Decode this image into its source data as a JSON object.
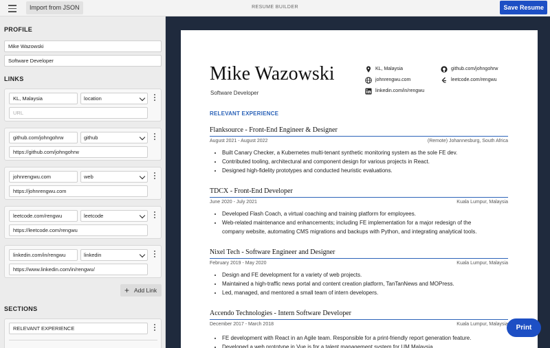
{
  "header": {
    "import_label": "Import from JSON",
    "app_title": "RESUME BUILDER",
    "save_label": "Save Resume"
  },
  "sidebar": {
    "profile_heading": "PROFILE",
    "name_value": "Mike Wazowski",
    "title_value": "Software Developer",
    "links_heading": "LINKS",
    "links": [
      {
        "label": "KL, Malaysia",
        "type": "location",
        "url": "",
        "url_placeholder": "URL"
      },
      {
        "label": "github.com/johngohrw",
        "type": "github",
        "url": "https://github.com/johngohrw"
      },
      {
        "label": "johnrengwu.com",
        "type": "web",
        "url": "https://johnrengwu.com"
      },
      {
        "label": "leetcode.com/rengwu",
        "type": "leetcode",
        "url": "https://leetcode.com/rengwu"
      },
      {
        "label": "linkedin.com/in/rengwu",
        "type": "linkedin",
        "url": "https://www.linkedin.com/in/rengwu/"
      }
    ],
    "add_link_label": "Add Link",
    "sections_heading": "SECTIONS",
    "section_items": [
      "RELEVANT EXPERIENCE"
    ]
  },
  "resume": {
    "name": "Mike Wazowski",
    "title": "Software Developer",
    "contacts": {
      "location": "KL, Malaysia",
      "github": "github.com/johngohrw",
      "web": "johnrengwu.com",
      "leetcode": "leetcode.com/rengwu",
      "linkedin": "linkedin.com/in/rengwu"
    },
    "section_title": "RELEVANT EXPERIENCE",
    "jobs": [
      {
        "title": "Flanksource - Front-End Engineer & Designer",
        "dates": "August 2021 - August 2022",
        "location": "(Remote) Johannesburg, South Africa",
        "bullets": [
          "Built Canary Checker, a Kubernetes multi-tenant synthetic monitoring system as the sole FE dev.",
          "Contributed tooling, architectural and component design for various projects in React.",
          "Designed high-fidelity prototypes and conducted heuristic evaluations."
        ]
      },
      {
        "title": "TDCX - Front-End Developer",
        "dates": "June 2020 - July 2021",
        "location": "Kuala Lumpur, Malaysia",
        "bullets": [
          "Developed Flash Coach, a virtual coaching and training platform for employees.",
          "Web-related maintenance and enhancements; including FE implementation for a major redesign of the",
          "company website, automating CMS migrations and backups with Python, and integrating analytical tools."
        ]
      },
      {
        "title": "Nixel Tech - Software Engineer and Designer",
        "dates": "February 2019 - May 2020",
        "location": "Kuala Lumpur, Malaysia",
        "bullets": [
          "Design and FE development for a variety of web projects.",
          "Maintained a high-traffic news portal and content creation platform, TanTanNews and MOPress.",
          "Led, managed, and mentored a small team of intern developers."
        ]
      },
      {
        "title": "Accendo Technologies - Intern Software Developer",
        "dates": "December 2017 - March 2018",
        "location": "Kuala Lumpur, Malaysia",
        "bullets": [
          "FE development with React in an Agile team. Responsible for a print-friendly report generation feature.",
          "Developed a web prototype in Vue.js for a talent management system for UM Malaysia"
        ]
      }
    ]
  },
  "print_label": "Print"
}
